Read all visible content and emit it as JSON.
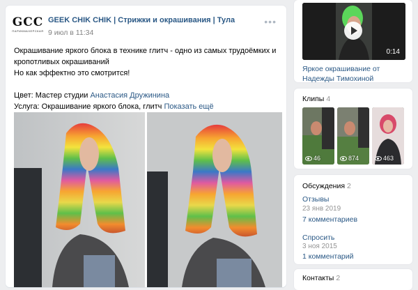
{
  "post": {
    "author": "GEEK CHIK CHIK | Стрижки и окрашивания | Тула",
    "logo_text": "GCC",
    "logo_sub": "ПАРИКМАХЕРСКАЯ",
    "date": "9 июл в 11:34",
    "more_label": "•••",
    "text_line1": "Окрашивание яркого блока в технике глитч - одно из самых трудоёмких и",
    "text_line2": "кропотливых окрашиваний",
    "text_line3": "Но как эффектно это смотрится!",
    "color_prefix": "Цвет: Мастер студии ",
    "color_master": "Анастасия Дружинина",
    "service_prefix": "Услуга: Окрашивание яркого блока, глитч",
    "show_more": "Показать ещё"
  },
  "sidebar": {
    "video": {
      "duration": "0:14",
      "title": "Яркое окрашивание от Надежды Тимохиной"
    },
    "clips": {
      "title": "Клипы",
      "count": "4",
      "items": [
        {
          "views": "46"
        },
        {
          "views": "874"
        },
        {
          "views": "463"
        }
      ]
    },
    "discussions": {
      "title": "Обсуждения",
      "count": "2",
      "topics": [
        {
          "title": "Отзывы",
          "date": "23 янв 2019",
          "comments": "7 комментариев"
        },
        {
          "title": "Спросить",
          "date": "3 ноя 2015",
          "comments": "1 комментарий"
        }
      ]
    },
    "contacts": {
      "title": "Контакты",
      "count": "2"
    }
  },
  "colors": {
    "link": "#2a5885",
    "background": "#edeef0",
    "muted": "#828282"
  }
}
